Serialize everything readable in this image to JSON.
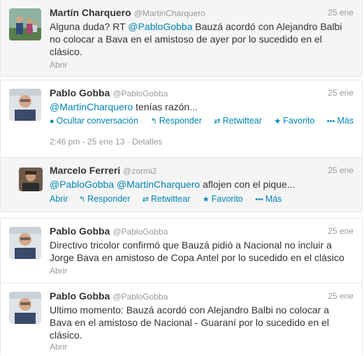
{
  "tweets": [
    {
      "name": "Martín Charquero",
      "handle": "@MartinCharquero",
      "time": "25 ene",
      "text_pre": "Alguna duda? RT ",
      "mention1": "@PabloGobba",
      "text_post": " Bauzá acordó con Alejandro Balbi no colocar a Bava en el amistoso de ayer por lo sucedido en el clásico.",
      "open": "Abrir"
    },
    {
      "name": "Pablo Gobba",
      "handle": "@PabloGobba",
      "time": "25 ene",
      "mention1": "@MartinCharquero",
      "text_post": " tenías razón...",
      "actions": {
        "hide": "Ocultar conversación",
        "reply": "Responder",
        "retweet": "Retwittear",
        "favorite": "Favorito",
        "more": "Más"
      },
      "meta": "2:46 pm - 25 ene 13 · Detalles"
    },
    {
      "name": "Marcelo Ferreri",
      "handle": "@zormi2",
      "time": "25 ene",
      "mention1": "@PabloGobba",
      "mention2": "@MartinCharquero",
      "text_post": " aflojen con el pique...",
      "actions": {
        "open": "Abrir",
        "reply": "Responder",
        "retweet": "Retwittear",
        "favorite": "Favorito",
        "more": "Más"
      }
    },
    {
      "name": "Pablo Gobba",
      "handle": "@PabloGobba",
      "time": "25 ene",
      "text": "Directivo tricolor confirmó que Bauzá pidió a Nacional no incluir a Jorge Bava en amistoso de Copa Antel por lo sucedido en el clásico",
      "open": "Abrir"
    },
    {
      "name": "Pablo Gobba",
      "handle": "@PabloGobba",
      "time": "25 ene",
      "text": "Ultimo momento: Bauzá acordó con Alejandro Balbi no colocar a Bava en el amistoso de Nacional - Guaraní por lo sucedido en el clásico.",
      "open": "Abrir"
    }
  ],
  "colors": {
    "link": "#0084b4",
    "muted": "#999999",
    "panel_bg": "#f5f8fa"
  }
}
